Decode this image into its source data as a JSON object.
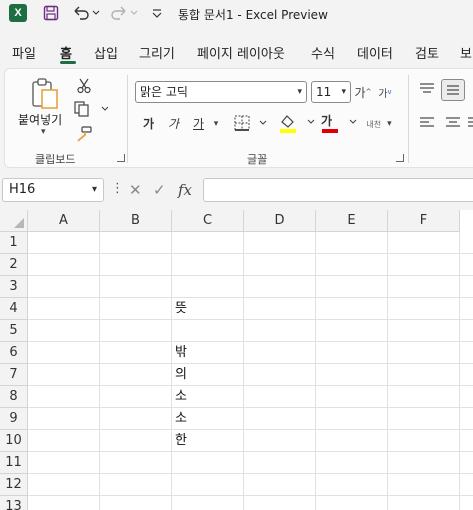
{
  "titlebar": {
    "title": "통합 문서1  -  Excel Preview",
    "logo_letter": "X",
    "icons": [
      "save-icon",
      "undo-icon",
      "redo-icon",
      "customize-qat-icon"
    ]
  },
  "menu": {
    "tabs": [
      "파일",
      "홈",
      "삽입",
      "그리기",
      "페이지 레이아웃",
      "수식",
      "데이터",
      "검토",
      "보"
    ],
    "active": "홈"
  },
  "ribbon": {
    "clipboard": {
      "paste_label": "붙여넣기",
      "group_label": "클립보드"
    },
    "font": {
      "font_name": "맑은 고딕",
      "font_size": "11",
      "bold": "가",
      "italic": "가",
      "underline": "가",
      "text_color_glyph": "가",
      "phonetic": "내천",
      "group_label": "글꼴",
      "fill_color": "#ffff00",
      "text_color": "#e00000"
    }
  },
  "formula_bar": {
    "name_box": "H16",
    "value": ""
  },
  "grid": {
    "columns": [
      "A",
      "B",
      "C",
      "D",
      "E",
      "F"
    ],
    "rows": [
      "1",
      "2",
      "3",
      "4",
      "5",
      "6",
      "7",
      "8",
      "9",
      "10",
      "11",
      "12",
      "13"
    ],
    "cells": [
      {
        "ref": "C4",
        "value": "뜻"
      },
      {
        "ref": "C6",
        "value": "밖"
      },
      {
        "ref": "C7",
        "value": "의"
      },
      {
        "ref": "C8",
        "value": "소"
      },
      {
        "ref": "C9",
        "value": "소"
      },
      {
        "ref": "C10",
        "value": "한"
      }
    ]
  },
  "colors": {
    "accent": "#1d6f42",
    "qat_icon": "#6b2e7e"
  }
}
